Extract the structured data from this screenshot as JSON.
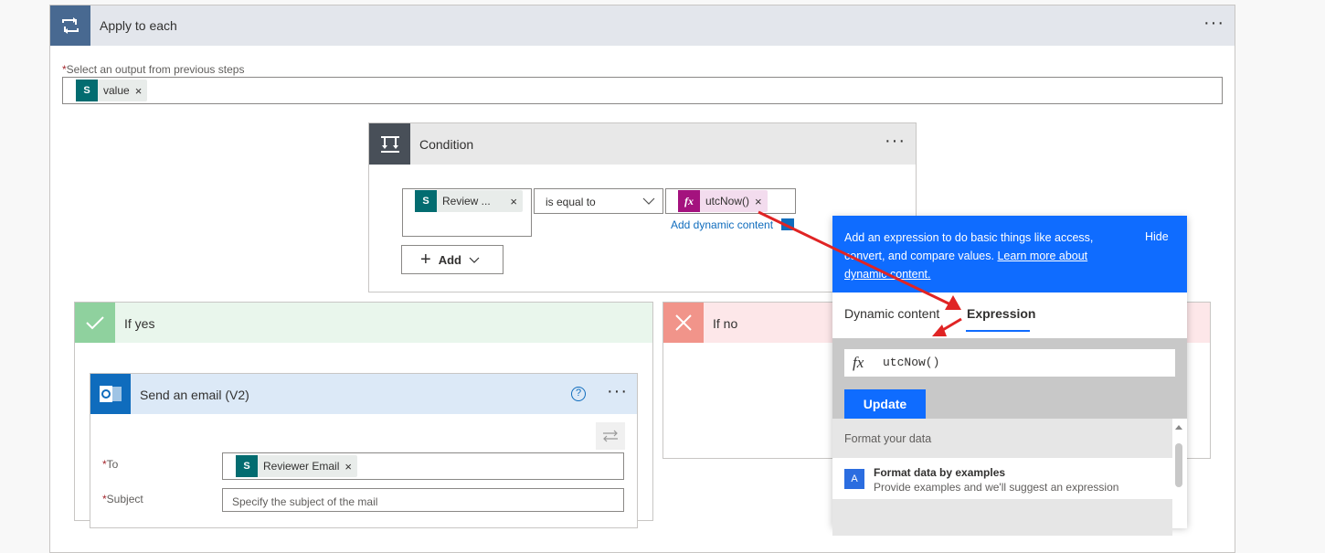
{
  "apply_each": {
    "title": "Apply to each",
    "field_label": "Select an output from previous steps",
    "token_label": "value"
  },
  "condition": {
    "title": "Condition",
    "left_token": "Review ...",
    "operator": "is equal to",
    "right_token": "utcNow()",
    "add_dynamic": "Add dynamic content",
    "add_button": "Add"
  },
  "if_yes": {
    "title": "If yes"
  },
  "if_no": {
    "title": "If no"
  },
  "email": {
    "title": "Send an email (V2)",
    "to_label": "To",
    "to_token": "Reviewer Email",
    "subject_label": "Subject",
    "subject_placeholder": "Specify the subject of the mail"
  },
  "popup": {
    "description": "Add an expression to do basic things like access, convert, and compare values.",
    "learn_more": "Learn more about dynamic content.",
    "hide": "Hide",
    "tab_dynamic": "Dynamic content",
    "tab_expression": "Expression",
    "expression_value": "utcNow()",
    "update_button": "Update",
    "section_title": "Format your data",
    "item_title": "Format data by examples",
    "item_desc": "Provide examples and we'll suggest an expression"
  },
  "icons": {
    "loop": "loop-icon",
    "condition": "condition-icon",
    "sharepoint": "sharepoint-icon",
    "fx": "fx-icon",
    "check": "check-icon",
    "close": "close-icon",
    "outlook": "outlook-icon",
    "help": "help-icon",
    "swap": "swap-icon"
  },
  "colors": {
    "accent": "#0f6cff",
    "sharepoint": "#036c70",
    "fx": "#a4127e",
    "arrow": "#e02424"
  }
}
